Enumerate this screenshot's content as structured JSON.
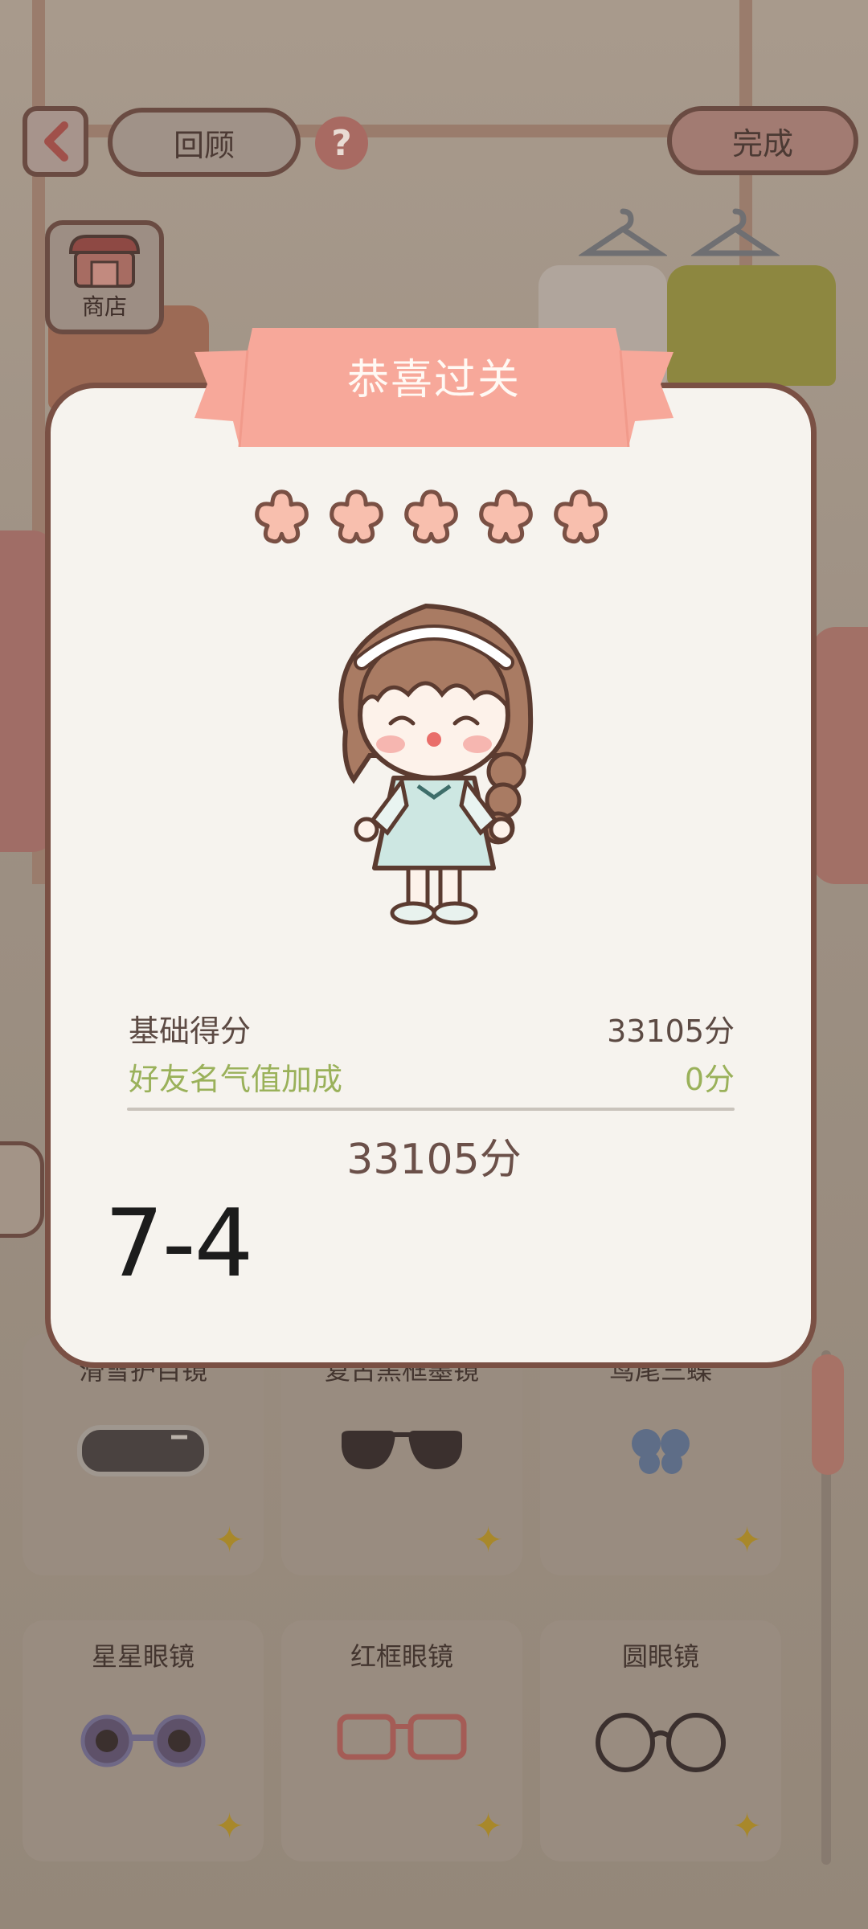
{
  "top_bar": {
    "review_label": "回顾",
    "help_symbol": "?",
    "done_label": "完成",
    "shop_label": "商店"
  },
  "modal": {
    "title": "恭喜过关",
    "stars_earned": 5,
    "stars_total": 5,
    "base_score_label": "基础得分",
    "base_score_value": "33105分",
    "bonus_label": "好友名气值加成",
    "bonus_value": "0分",
    "total_score": "33105分",
    "level_text": "7-4"
  },
  "items": [
    {
      "name": "滑雪护目镜",
      "icon": "ski-goggles-icon"
    },
    {
      "name": "复古黑框墨镜",
      "icon": "black-sunglasses-icon"
    },
    {
      "name": "鸢尾三蝶",
      "icon": "butterfly-icon"
    },
    {
      "name": "星星眼镜",
      "icon": "flower-glasses-icon"
    },
    {
      "name": "红框眼镜",
      "icon": "red-frame-glasses-icon"
    },
    {
      "name": "圆眼镜",
      "icon": "round-glasses-icon"
    }
  ],
  "colors": {
    "ribbon": "#f7a89a",
    "star_fill": "#f8bfae",
    "outline": "#7a5044",
    "bonus_text": "#9ab15a"
  }
}
